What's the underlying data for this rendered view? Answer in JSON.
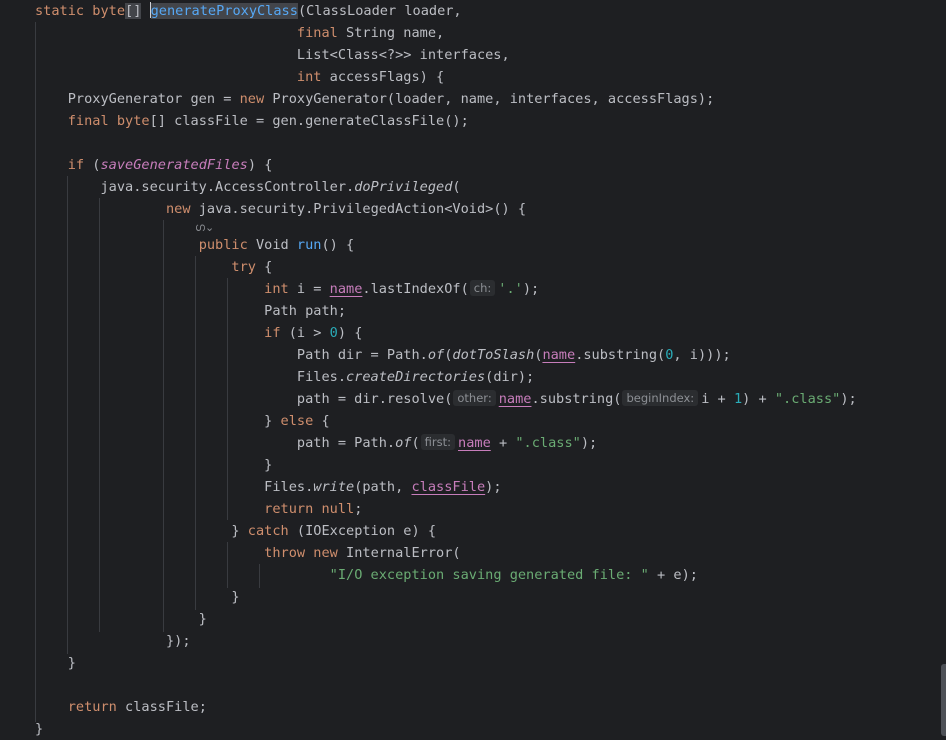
{
  "editor": {
    "language": "Java",
    "method_name": "generateProxyClass",
    "hints": {
      "ch": "ch:",
      "other": "other:",
      "beginIndex": "beginIndex:",
      "first": "first:"
    },
    "colors": {
      "background": "#1e1f22",
      "keyword": "#cf8e6d",
      "method_declaration": "#56a8f5",
      "static_field": "#c77dbb",
      "string": "#6aab73",
      "number": "#2aacb8"
    },
    "icons": [
      "lambda-icon",
      "chevron-down-icon"
    ]
  }
}
